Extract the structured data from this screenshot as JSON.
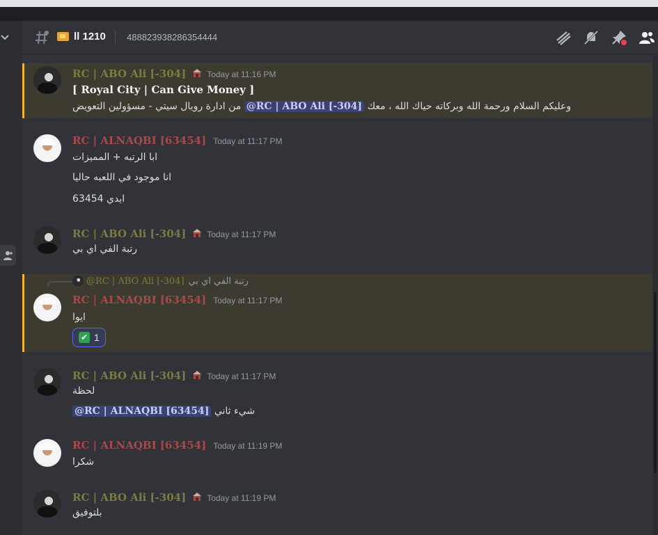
{
  "header": {
    "channel_name": "ll 1210",
    "topic": "488823938286354444"
  },
  "messages": [
    {
      "author": "RC | ABO Ali [-304]",
      "timestamp": "Today at 11:16 PM",
      "lines": [
        "[   Royal City |  Can Give Money  ]"
      ],
      "arabic_prefix": "وعليكم السلام ورحمة الله وبركاته حياك الله ، معك",
      "mention": "@RC | ABO Ali [-304]",
      "arabic_suffix": "من ادارة رويال سيتي - مسؤولين التعويض"
    },
    {
      "author": "RC | ALNAQBI [63454]",
      "timestamp": "Today at 11:17 PM",
      "lines": [
        "ابا الرتبه + المميزات",
        "انا موجود في اللعبه حاليا",
        "ايدي 63454"
      ]
    },
    {
      "author": "RC | ABO Ali [-304]",
      "timestamp": "Today at 11:17 PM",
      "lines": [
        "رتبة الفي اي بي"
      ]
    },
    {
      "reply_user": "@RC | ABO Ali [-304]",
      "reply_text": "رتبة الفي اي بي",
      "author": "RC | ALNAQBI [63454]",
      "timestamp": "Today at 11:17 PM",
      "lines": [
        "ايوا"
      ],
      "reaction": {
        "emoji": "✔",
        "count": "1"
      }
    },
    {
      "author": "RC | ABO Ali [-304]",
      "timestamp": "Today at 11:17 PM",
      "lines": [
        "لحظة"
      ],
      "mention": "@RC | ALNAQBI [63454]",
      "after_mention": "شيء ثاني"
    },
    {
      "author": "RC | ALNAQBI [63454]",
      "timestamp": "Today at 11:19 PM",
      "lines": [
        "شكرا"
      ]
    },
    {
      "author": "RC | ABO Ali [-304]",
      "timestamp": "Today at 11:19 PM",
      "lines": [
        "بلتوفيق"
      ]
    }
  ],
  "colors": {
    "background": "#313338",
    "highlight_bg": "#3d3a2f",
    "highlight_border": "#f0b232",
    "abo_ali": "#7c7a45",
    "alnaqbi": "#a94a4a",
    "mention_bg": "#3c4270"
  },
  "icons": [
    "hash-icon",
    "threads-icon",
    "mute-icon",
    "pin-icon",
    "members-icon",
    "chevron-down-icon",
    "add-member-icon",
    "role-icon",
    "check-icon"
  ]
}
